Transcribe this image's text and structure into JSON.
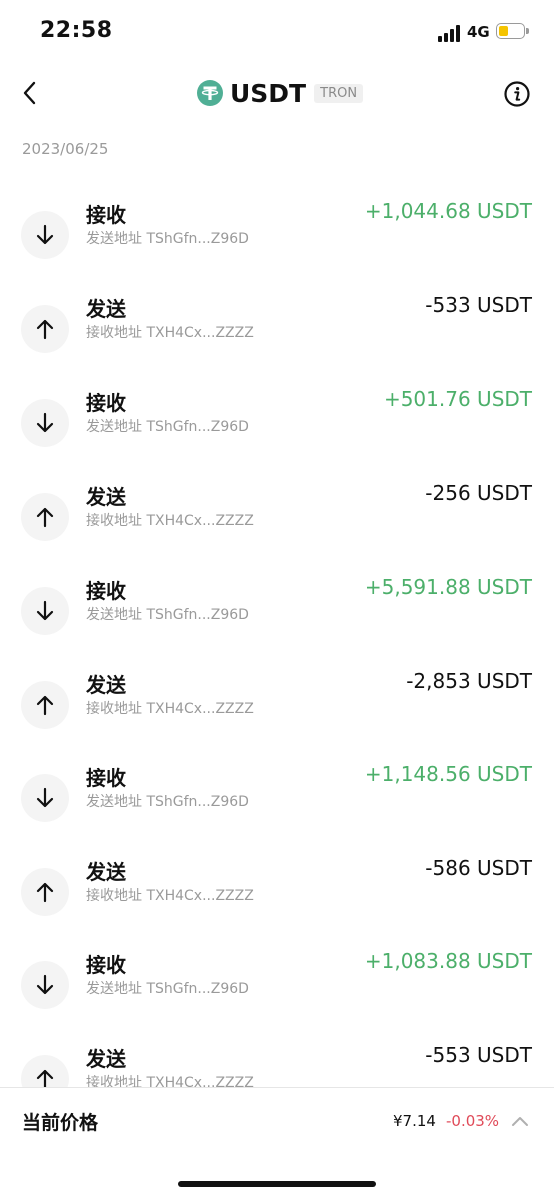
{
  "status_bar": {
    "time": "22:58",
    "network": "4G"
  },
  "header": {
    "token_name": "USDT",
    "chain": "TRON",
    "back_icon": "chevron-left-icon",
    "info_icon": "info-icon"
  },
  "date_group": "2023/06/25",
  "transactions": [
    {
      "type": "接收",
      "direction": "in",
      "address": "发送地址 TShGfn...Z96D",
      "amount": "+1,044.68 USDT"
    },
    {
      "type": "发送",
      "direction": "out",
      "address": "接收地址 TXH4Cx...ZZZZ",
      "amount": "-533 USDT"
    },
    {
      "type": "接收",
      "direction": "in",
      "address": "发送地址 TShGfn...Z96D",
      "amount": "+501.76 USDT"
    },
    {
      "type": "发送",
      "direction": "out",
      "address": "接收地址 TXH4Cx...ZZZZ",
      "amount": "-256 USDT"
    },
    {
      "type": "接收",
      "direction": "in",
      "address": "发送地址 TShGfn...Z96D",
      "amount": "+5,591.88 USDT"
    },
    {
      "type": "发送",
      "direction": "out",
      "address": "接收地址 TXH4Cx...ZZZZ",
      "amount": "-2,853 USDT"
    },
    {
      "type": "接收",
      "direction": "in",
      "address": "发送地址 TShGfn...Z96D",
      "amount": "+1,148.56 USDT"
    },
    {
      "type": "发送",
      "direction": "out",
      "address": "接收地址 TXH4Cx...ZZZZ",
      "amount": "-586 USDT"
    },
    {
      "type": "接收",
      "direction": "in",
      "address": "发送地址 TShGfn...Z96D",
      "amount": "+1,083.88 USDT"
    },
    {
      "type": "发送",
      "direction": "out",
      "address": "接收地址 TXH4Cx...ZZZZ",
      "amount": "-553 USDT"
    }
  ],
  "price_bar": {
    "label": "当前价格",
    "price": "¥7.14",
    "change": "-0.03%"
  },
  "colors": {
    "positive": "#4caf6a",
    "negative_change": "#e04a58",
    "usdt_brand": "#50af95"
  }
}
